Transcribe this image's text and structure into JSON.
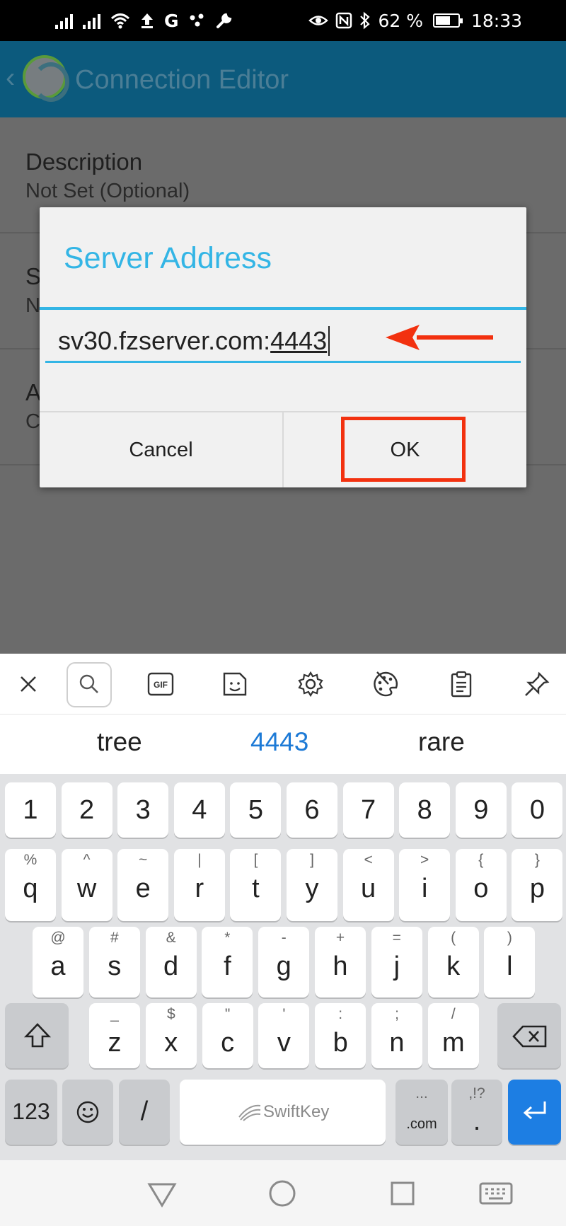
{
  "status_bar": {
    "network": "G",
    "battery": "62 %",
    "battery_level": 0.62,
    "time": "18:33"
  },
  "app_bar": {
    "title": "Connection Editor"
  },
  "settings": [
    {
      "title": "Description",
      "summary": "Not Set (Optional)"
    },
    {
      "title": "S",
      "summary": "N"
    },
    {
      "title": "A",
      "summary": "C"
    }
  ],
  "dialog": {
    "title": "Server Address",
    "value_prefix": "sv30.fzserver.com:",
    "value_composing": "4443",
    "cancel_label": "Cancel",
    "ok_label": "OK",
    "accent_color": "#33b5e5",
    "annotation_color": "#f2310f"
  },
  "keyboard": {
    "toolbar_icons": [
      "close-icon",
      "search-icon",
      "gif-icon",
      "sticker-icon",
      "settings-icon",
      "theme-palette-icon",
      "clipboard-icon",
      "pin-icon"
    ],
    "gif_label": "GIF",
    "suggestions": [
      "tree",
      "4443",
      "rare"
    ],
    "number_row": [
      "1",
      "2",
      "3",
      "4",
      "5",
      "6",
      "7",
      "8",
      "9",
      "0"
    ],
    "row1": [
      {
        "key": "q",
        "alt": "%"
      },
      {
        "key": "w",
        "alt": "^"
      },
      {
        "key": "e",
        "alt": "~"
      },
      {
        "key": "r",
        "alt": "|"
      },
      {
        "key": "t",
        "alt": "["
      },
      {
        "key": "y",
        "alt": "]"
      },
      {
        "key": "u",
        "alt": "<"
      },
      {
        "key": "i",
        "alt": ">"
      },
      {
        "key": "o",
        "alt": "{"
      },
      {
        "key": "p",
        "alt": "}"
      }
    ],
    "row2": [
      {
        "key": "a",
        "alt": "@"
      },
      {
        "key": "s",
        "alt": "#"
      },
      {
        "key": "d",
        "alt": "&"
      },
      {
        "key": "f",
        "alt": "*"
      },
      {
        "key": "g",
        "alt": "-"
      },
      {
        "key": "h",
        "alt": "+"
      },
      {
        "key": "j",
        "alt": "="
      },
      {
        "key": "k",
        "alt": "("
      },
      {
        "key": "l",
        "alt": ")"
      }
    ],
    "row3": [
      {
        "key": "z",
        "alt": "_"
      },
      {
        "key": "x",
        "alt": "$"
      },
      {
        "key": "c",
        "alt": "\""
      },
      {
        "key": "v",
        "alt": "'"
      },
      {
        "key": "b",
        "alt": ":"
      },
      {
        "key": "n",
        "alt": ";"
      },
      {
        "key": "m",
        "alt": "/"
      }
    ],
    "bottom_row": {
      "symbols": "123",
      "emoji_icon": "emoji-icon",
      "slash": "/",
      "space_brand": "SwiftKey",
      "dotcom_alt": "...",
      "dotcom": ".com",
      "period_alt": ",!?",
      "period": ".",
      "enter_icon": "enter-icon",
      "enter_color": "#1d7ee3"
    }
  },
  "nav_bar": {
    "icons": [
      "back-icon",
      "home-icon",
      "recents-icon",
      "keyboard-icon"
    ]
  }
}
